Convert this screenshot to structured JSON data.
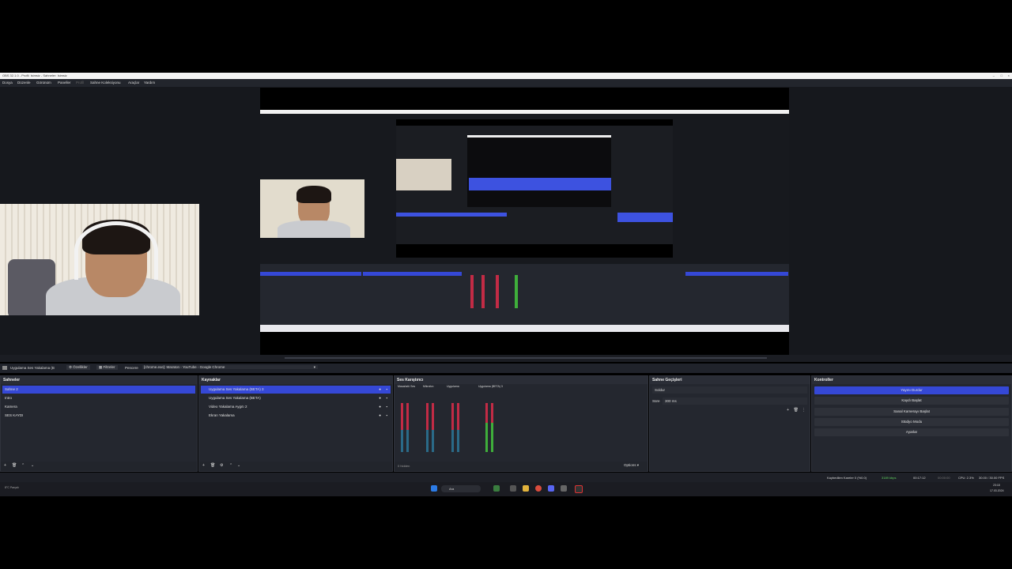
{
  "window": {
    "title": "OBS 32.1.0 - Profil: Isimsiz - Sahneler: Isimsiz"
  },
  "menu": [
    "Dosya",
    "Düzenle",
    "Görünüm",
    "Paneller",
    "Profil",
    "Sahne Koleksiyonu",
    "Araçlar",
    "Yardım"
  ],
  "propbar": {
    "source": "Uygulama Ses Yakalama (B",
    "props_label": "Özellikler",
    "filters_label": "Filtreler",
    "window_label": "Pencere",
    "window_value": "[chrome.exe]: Maraton - YouTube - Google Chrome"
  },
  "scenes": {
    "title": "Sahneler",
    "items": [
      "Sahne 2",
      "Intro",
      "Kamera",
      "SES KAYDI"
    ],
    "selected": 0
  },
  "sources": {
    "title": "Kaynaklar",
    "items": [
      "Uygulama Ses Yakalama (BETA) 3",
      "Uygulama Ses Yakalama (BETA)",
      "Video Yakalama Aygıtı 2",
      "Ekran Yakalama"
    ],
    "selected": 0
  },
  "mixer": {
    "title": "Ses Karıştırıcı",
    "channels": [
      "Masaüstü Ses",
      "Mikrofon",
      "Uygulama",
      "Uygulama (BETA) 3"
    ],
    "footer": "0 hidden",
    "options_label": "Options"
  },
  "transitions": {
    "title": "Sahne Geçişleri",
    "selected": "Soldur",
    "duration_label": "Süre",
    "duration_value": "300 ms"
  },
  "controls": {
    "title": "Kontroller",
    "buttons": [
      "Yayını Durdur",
      "Kaydı Başlat",
      "Sanal Kamerayı Başlat",
      "Stüdyo Modu",
      "Ayarlar"
    ]
  },
  "status": {
    "dropped": "Kaybedilen Kareler 0 (%0.0)",
    "bitrate": "3189 kbps",
    "stream_time": "00:17:12",
    "rec_time": "00:00:00",
    "cpu": "CPU: 2.3%",
    "fps": "30.00 / 30.00 FPS"
  },
  "taskbar": {
    "search_placeholder": "Ara",
    "clock_time": "23:18",
    "clock_date": "17.03.2024",
    "weather": "8°C Parçalı"
  },
  "colors": {
    "accent": "#3548d6",
    "bg": "#1d1f26",
    "panel": "#24272f"
  }
}
